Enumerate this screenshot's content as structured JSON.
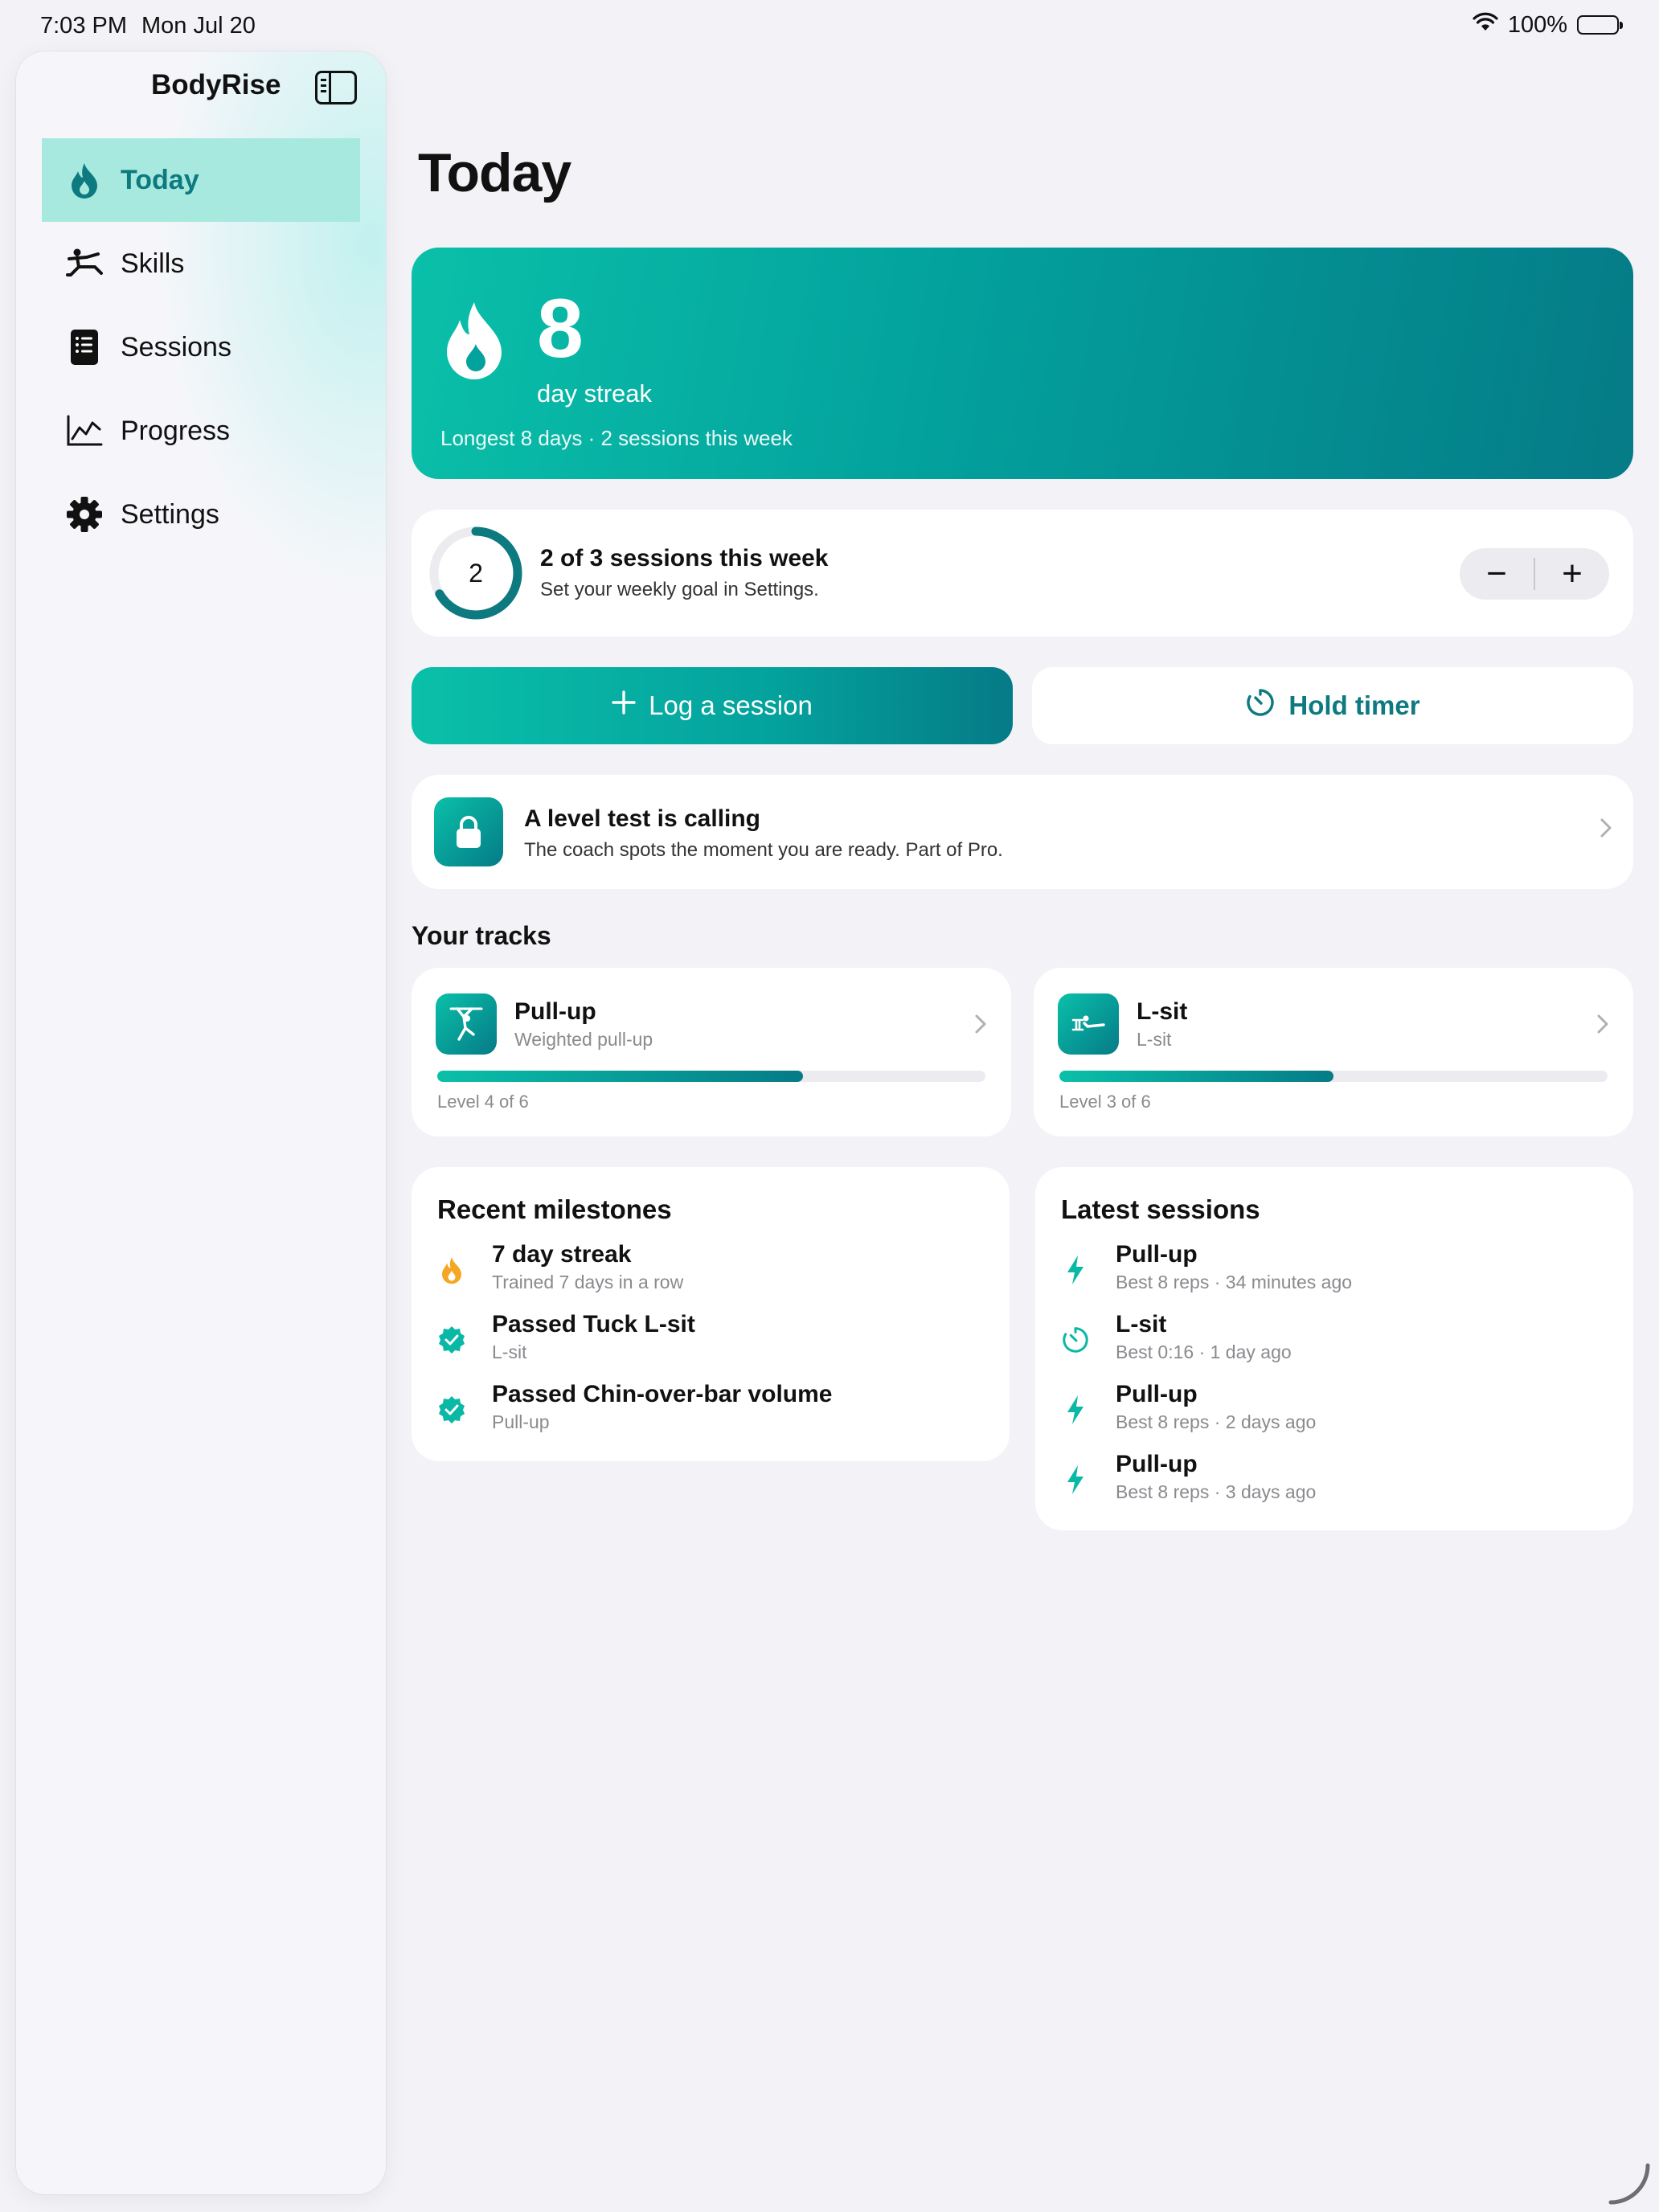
{
  "status_bar": {
    "time": "7:03 PM",
    "date": "Mon Jul 20",
    "battery": "100%"
  },
  "sidebar": {
    "app_name": "BodyRise",
    "items": [
      {
        "label": "Today",
        "icon": "flame-icon",
        "active": true
      },
      {
        "label": "Skills",
        "icon": "figure-skill-icon",
        "active": false
      },
      {
        "label": "Sessions",
        "icon": "list-icon",
        "active": false
      },
      {
        "label": "Progress",
        "icon": "chart-line-icon",
        "active": false
      },
      {
        "label": "Settings",
        "icon": "gear-icon",
        "active": false
      }
    ]
  },
  "main": {
    "title": "Today",
    "streak": {
      "number": "8",
      "label": "day streak",
      "subtitle": "Longest 8 days · 2 sessions this week"
    },
    "weekly_goal": {
      "ring_value": "2",
      "progress": 0.6667,
      "title": "2 of 3 sessions this week",
      "subtitle": "Set your weekly goal in Settings.",
      "minus": "−",
      "plus": "+"
    },
    "actions": {
      "log_label": "Log a session",
      "hold_label": "Hold timer"
    },
    "promo": {
      "title": "A level test is calling",
      "subtitle": "The coach spots the moment you are ready. Part of Pro."
    },
    "tracks_heading": "Your tracks",
    "tracks": [
      {
        "name": "Pull-up",
        "subtitle": "Weighted pull-up",
        "level": "Level 4 of 6",
        "progress": 0.667,
        "icon": "pullup-figure-icon"
      },
      {
        "name": "L-sit",
        "subtitle": "L-sit",
        "level": "Level 3 of 6",
        "progress": 0.5,
        "icon": "lsit-figure-icon"
      }
    ],
    "milestones": {
      "title": "Recent milestones",
      "items": [
        {
          "title": "7 day streak",
          "subtitle": "Trained 7 days in a row",
          "icon": "flame-icon",
          "color": "#f5a623"
        },
        {
          "title": "Passed Tuck L-sit",
          "subtitle": "L-sit",
          "icon": "check-seal-icon",
          "color": "#0ab8a6"
        },
        {
          "title": "Passed Chin-over-bar volume",
          "subtitle": "Pull-up",
          "icon": "check-seal-icon",
          "color": "#0ab8a6"
        }
      ]
    },
    "latest_sessions": {
      "title": "Latest sessions",
      "items": [
        {
          "title": "Pull-up",
          "subtitle": "Best 8 reps · 34 minutes ago",
          "icon": "bolt-icon"
        },
        {
          "title": "L-sit",
          "subtitle": "Best 0:16 · 1 day ago",
          "icon": "timer-icon"
        },
        {
          "title": "Pull-up",
          "subtitle": "Best 8 reps · 2 days ago",
          "icon": "bolt-icon"
        },
        {
          "title": "Pull-up",
          "subtitle": "Best 8 reps · 3 days ago",
          "icon": "bolt-icon"
        }
      ]
    }
  },
  "colors": {
    "accent": "#0d7a80",
    "gradient_start": "#0ac0a9",
    "gradient_end": "#057b87",
    "milestone_flame": "#f5a623"
  }
}
